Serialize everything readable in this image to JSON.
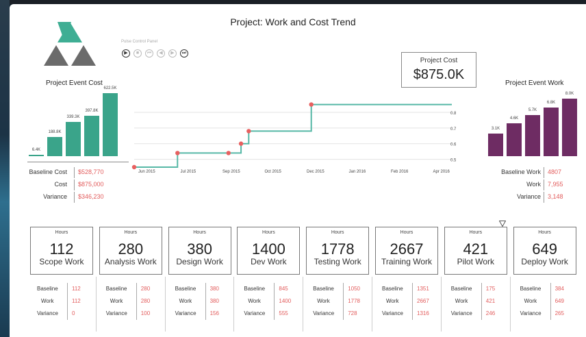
{
  "title": "Project: Work and Cost Trend",
  "play_control": {
    "label": "Pulse Control Panel",
    "buttons": [
      {
        "icon": "play-icon",
        "glyph": "▶"
      },
      {
        "icon": "stop-icon",
        "glyph": "■"
      },
      {
        "icon": "skip-back-icon",
        "glyph": "⏮"
      },
      {
        "icon": "step-back-icon",
        "glyph": "◀"
      },
      {
        "icon": "step-forward-icon",
        "glyph": "▶"
      },
      {
        "icon": "skip-forward-icon",
        "glyph": "⏭"
      }
    ]
  },
  "project_cost": {
    "label": "Project Cost",
    "value": "$875.0K"
  },
  "event_cost": {
    "title": "Project Event Cost",
    "color": "#3aa48a",
    "bar_labels": [
      "6.4K",
      "188.8K",
      "339.3K",
      "397.8K",
      "622.5K"
    ],
    "values": [
      6.4,
      188.8,
      339.3,
      397.8,
      622.5
    ],
    "stats": [
      {
        "key": "Baseline Cost",
        "value": "$528,770"
      },
      {
        "key": "Cost",
        "value": "$875,000"
      },
      {
        "key": "Variance",
        "value": "$346,230"
      }
    ]
  },
  "event_work": {
    "title": "Project Event Work",
    "color": "#6e2c63",
    "bar_labels": [
      "3.1K",
      "4.6K",
      "5.7K",
      "6.8K",
      "8.0K"
    ],
    "values": [
      3.1,
      4.6,
      5.7,
      6.8,
      8.0
    ],
    "stats": [
      {
        "key": "Baseline Work",
        "value": "4807"
      },
      {
        "key": "Work",
        "value": "7,955"
      },
      {
        "key": "Variance",
        "value": "3,148"
      }
    ]
  },
  "chart_data": {
    "type": "line",
    "line_color": "#56b8a6",
    "point_color": "#e86060",
    "x_ticks": [
      "Jun 2015",
      "Jul 2015",
      "Sep 2015",
      "Oct 2015",
      "Dec 2015",
      "Jan 2016",
      "Feb 2016",
      "Apr 2016"
    ],
    "y_ticks": [
      "0.50M",
      "0.60M",
      "0.70M",
      "0.80M"
    ],
    "ylim": [
      0.45,
      0.87
    ],
    "x_range": [
      "2015-05-24",
      "2016-04-18"
    ],
    "points": [
      {
        "x": "2015-05-24",
        "y": 0.45
      },
      {
        "x": "2015-07-08",
        "y": 0.54
      },
      {
        "x": "2015-08-30",
        "y": 0.54
      },
      {
        "x": "2015-09-12",
        "y": 0.6
      },
      {
        "x": "2015-09-20",
        "y": 0.68
      },
      {
        "x": "2015-11-24",
        "y": 0.85
      }
    ],
    "end": {
      "x": "2016-04-18",
      "y": 0.85
    }
  },
  "hour_boxes": [
    {
      "header": "Hours",
      "value": "112",
      "name": "Scope Work",
      "baseline": "112",
      "work": "112",
      "variance": "0"
    },
    {
      "header": "Hours",
      "value": "280",
      "name": "Analysis Work",
      "baseline": "280",
      "work": "280",
      "variance": "100"
    },
    {
      "header": "Hours",
      "value": "380",
      "name": "Design Work",
      "baseline": "380",
      "work": "380",
      "variance": "156"
    },
    {
      "header": "Hours",
      "value": "1400",
      "name": "Dev Work",
      "baseline": "845",
      "work": "1400",
      "variance": "555"
    },
    {
      "header": "Hours",
      "value": "1778",
      "name": "Testing Work",
      "baseline": "1050",
      "work": "1778",
      "variance": "728"
    },
    {
      "header": "Hours",
      "value": "2667",
      "name": "Training Work",
      "baseline": "1351",
      "work": "2667",
      "variance": "1316"
    },
    {
      "header": "Hours",
      "value": "421",
      "name": "Pilot Work",
      "baseline": "175",
      "work": "421",
      "variance": "246"
    },
    {
      "header": "Hours",
      "value": "649",
      "name": "Deploy Work",
      "baseline": "384",
      "work": "649",
      "variance": "265"
    }
  ],
  "mini_labels": {
    "baseline": "Baseline",
    "work": "Work",
    "variance": "Variance"
  }
}
